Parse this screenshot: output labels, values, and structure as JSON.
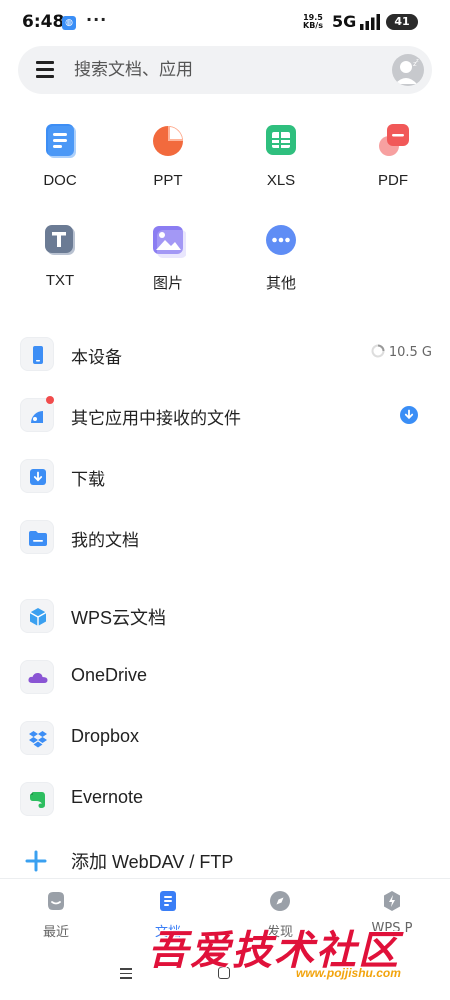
{
  "status_bar": {
    "time": "6:48",
    "notification_icon": "app-notification-icon",
    "more_dots": "···",
    "speed_value": "19.5",
    "speed_unit": "KB/s",
    "network": "5G",
    "battery": "41"
  },
  "search": {
    "placeholder": "搜索文档、应用"
  },
  "file_types": [
    {
      "label": "DOC",
      "color": "#3d8ef5"
    },
    {
      "label": "PPT",
      "color": "#f26a3d"
    },
    {
      "label": "XLS",
      "color": "#2fbf7e"
    },
    {
      "label": "PDF",
      "color": "#f15858"
    },
    {
      "label": "TXT",
      "color": "#6b7b94"
    },
    {
      "label": "图片",
      "color": "#8b7df2"
    },
    {
      "label": "其他",
      "color": "#5f8df5"
    }
  ],
  "locations": [
    {
      "label": "本设备",
      "icon": "phone-icon",
      "right_text": "10.5 G"
    },
    {
      "label": "其它应用中接收的文件",
      "icon": "receive-icon"
    },
    {
      "label": "下载",
      "icon": "download-icon"
    },
    {
      "label": "我的文档",
      "icon": "folder-icon"
    }
  ],
  "cloud": [
    {
      "label": "WPS云文档",
      "icon": "wps-cloud-icon"
    },
    {
      "label": "OneDrive",
      "icon": "onedrive-icon"
    },
    {
      "label": "Dropbox",
      "icon": "dropbox-icon"
    },
    {
      "label": "Evernote",
      "icon": "evernote-icon"
    },
    {
      "label": "添加 WebDAV / FTP",
      "icon": "add-icon"
    }
  ],
  "bottom_nav": [
    {
      "label": "最近",
      "icon": "recent-icon"
    },
    {
      "label": "文档",
      "icon": "document-icon",
      "active": true
    },
    {
      "label": "发现",
      "icon": "compass-icon"
    },
    {
      "label": "WPS P",
      "icon": "bolt-icon"
    }
  ],
  "watermark": {
    "title": "吾爱技术社区",
    "url": "www.pojjishu.com"
  },
  "colors": {
    "accent": "#3a7ef6",
    "text": "#222222"
  }
}
